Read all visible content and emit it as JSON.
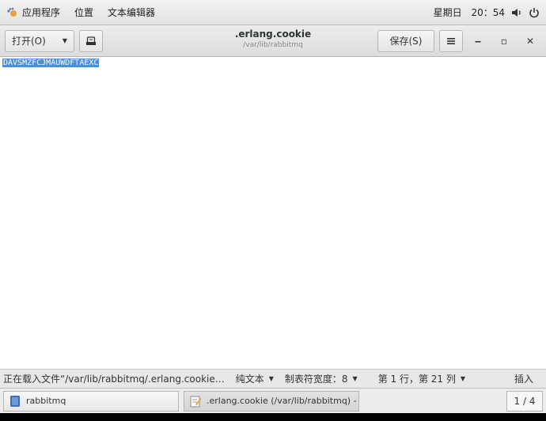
{
  "top_panel": {
    "applications": "应用程序",
    "places": "位置",
    "current_app": "文本编辑器",
    "day": "星期日",
    "time": "20：54"
  },
  "headerbar": {
    "open_label": "打开(O)",
    "title": ".erlang.cookie",
    "subtitle": "/var/lib/rabbitmq",
    "save_label": "保存(S)",
    "minimize_glyph": "‒",
    "maximize_glyph": "▫",
    "close_glyph": "✕"
  },
  "editor": {
    "content": "DAVSMZFCJMAUWDFTAEXC"
  },
  "statusbar": {
    "message": "正在载入文件“/var/lib/rabbitmq/.erlang.cookie…",
    "syntax": "纯文本",
    "tab_width": "制表符宽度：8",
    "position": "第 1 行，第 21 列",
    "mode": "插入"
  },
  "taskbar": {
    "task1_label": "rabbitmq",
    "task2_label": ".erlang.cookie (/var/lib/rabbitmq) - …",
    "pager": "1 / 4"
  },
  "colors": {
    "selection": "#4a90d9",
    "panel": "#e8e8e7"
  },
  "icons": {
    "apps": "gnome-foot-icon",
    "recent": "recent-files-icon",
    "menu": "hamburger-icon",
    "volume": "volume-icon",
    "power": "power-icon",
    "folder": "folder-icon",
    "editor": "text-editor-icon"
  }
}
